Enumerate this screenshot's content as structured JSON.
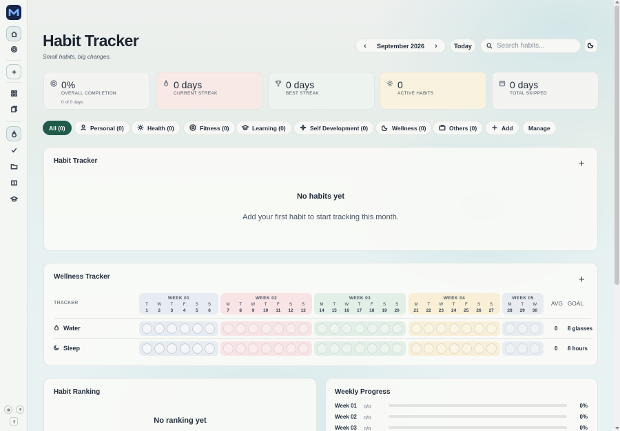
{
  "header": {
    "title": "Habit Tracker",
    "subtitle": "Small habits, big changes.",
    "month": "September 2026",
    "today_label": "Today",
    "search_placeholder": "Search habits..."
  },
  "stats": [
    {
      "value": "0%",
      "label": "OVERALL COMPLETION",
      "sub": "0 of 0 days",
      "icon": "target-icon",
      "color": "#f3f4f2"
    },
    {
      "value": "0 days",
      "label": "CURRENT STREAK",
      "icon": "flame-icon",
      "color": "#f8e9e6"
    },
    {
      "value": "0 days",
      "label": "BEST STREAK",
      "icon": "trophy-icon",
      "color": "#edf3ee"
    },
    {
      "value": "0",
      "label": "ACTIVE HABITS",
      "icon": "sun-icon",
      "color": "#f8f2df"
    },
    {
      "value": "0 days",
      "label": "TOTAL SKIPPED",
      "icon": "calendar-icon",
      "color": "#f3f4f2"
    }
  ],
  "categories": [
    {
      "label": "All (0)",
      "active": true
    },
    {
      "label": "Personal (0)",
      "icon": "person-icon"
    },
    {
      "label": "Health (0)",
      "icon": "sun-icon"
    },
    {
      "label": "Fitness (0)",
      "icon": "target-icon"
    },
    {
      "label": "Learning (0)",
      "icon": "graduation-icon"
    },
    {
      "label": "Self Development (0)",
      "icon": "sparkle-icon"
    },
    {
      "label": "Wellness (0)",
      "icon": "moon-icon"
    },
    {
      "label": "Others (0)",
      "icon": "briefcase-icon"
    },
    {
      "label": "Add",
      "icon": "plus-icon"
    },
    {
      "label": "Manage"
    }
  ],
  "habit_tracker": {
    "title": "Habit Tracker",
    "empty_title": "No habits yet",
    "empty_text": "Add your first habit to start tracking this month."
  },
  "wellness": {
    "title": "Wellness Tracker",
    "col_tracker": "TRACKER",
    "col_avg": "AVG",
    "col_goal": "GOAL",
    "weeks": [
      {
        "label": "WEEK 01",
        "color": "#e6ecf1",
        "days": [
          [
            "T",
            "1"
          ],
          [
            "W",
            "2"
          ],
          [
            "T",
            "3"
          ],
          [
            "F",
            "4"
          ],
          [
            "S",
            "5"
          ],
          [
            "S",
            "6"
          ]
        ]
      },
      {
        "label": "WEEK 02",
        "color": "#f8e3e5",
        "days": [
          [
            "M",
            "7"
          ],
          [
            "T",
            "8"
          ],
          [
            "W",
            "9"
          ],
          [
            "T",
            "10"
          ],
          [
            "F",
            "11"
          ],
          [
            "S",
            "12"
          ],
          [
            "S",
            "13"
          ]
        ]
      },
      {
        "label": "WEEK 03",
        "color": "#e2efe6",
        "days": [
          [
            "M",
            "14"
          ],
          [
            "T",
            "15"
          ],
          [
            "W",
            "16"
          ],
          [
            "T",
            "17"
          ],
          [
            "F",
            "18"
          ],
          [
            "S",
            "19"
          ],
          [
            "S",
            "20"
          ]
        ]
      },
      {
        "label": "WEEK 04",
        "color": "#f8efd6",
        "days": [
          [
            "M",
            "21"
          ],
          [
            "T",
            "22"
          ],
          [
            "W",
            "23"
          ],
          [
            "T",
            "24"
          ],
          [
            "F",
            "25"
          ],
          [
            "S",
            "26"
          ],
          [
            "S",
            "27"
          ]
        ]
      },
      {
        "label": "WEEK 05",
        "color": "#e8ecf0",
        "days": [
          [
            "M",
            "28"
          ],
          [
            "T",
            "29"
          ],
          [
            "W",
            "30"
          ]
        ]
      }
    ],
    "rows": [
      {
        "name": "Water",
        "icon": "droplet-icon",
        "avg": "0",
        "goal": "8 glasses"
      },
      {
        "name": "Sleep",
        "icon": "moon-icon",
        "avg": "0",
        "goal": "8 hours"
      }
    ]
  },
  "ranking": {
    "title": "Habit Ranking",
    "empty_title": "No ranking yet"
  },
  "weekly_progress": {
    "title": "Weekly Progress",
    "rows": [
      {
        "label": "Week 01",
        "value": "0/0",
        "percent": "0%"
      },
      {
        "label": "Week 02",
        "value": "0/0",
        "percent": "0%"
      },
      {
        "label": "Week 03",
        "value": "0/0",
        "percent": "0%"
      }
    ]
  }
}
